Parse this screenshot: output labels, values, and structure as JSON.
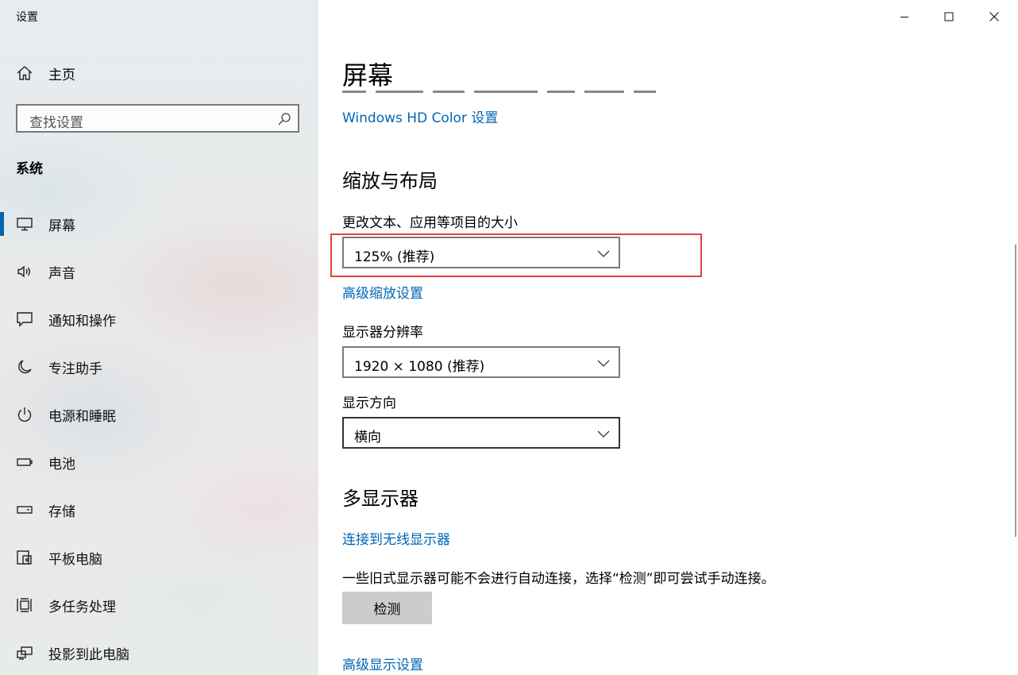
{
  "window": {
    "title": "设置",
    "controls": {
      "minimize": "minimize-icon",
      "maximize": "maximize-icon",
      "close": "close-icon"
    }
  },
  "sidebar": {
    "home_label": "主页",
    "search_placeholder": "查找设置",
    "section_label": "系统",
    "items": [
      {
        "label": "屏幕",
        "icon": "monitor-icon",
        "active": true
      },
      {
        "label": "声音",
        "icon": "speaker-icon"
      },
      {
        "label": "通知和操作",
        "icon": "notification-icon"
      },
      {
        "label": "专注助手",
        "icon": "moon-icon"
      },
      {
        "label": "电源和睡眠",
        "icon": "power-icon"
      },
      {
        "label": "电池",
        "icon": "battery-icon"
      },
      {
        "label": "存储",
        "icon": "storage-icon"
      },
      {
        "label": "平板电脑",
        "icon": "tablet-icon"
      },
      {
        "label": "多任务处理",
        "icon": "multitask-icon"
      },
      {
        "label": "投影到此电脑",
        "icon": "project-icon"
      }
    ]
  },
  "main": {
    "title": "屏幕",
    "hd_color_link": "Windows HD Color 设置",
    "scale_section": {
      "heading": "缩放与布局",
      "size_label": "更改文本、应用等项目的大小",
      "size_value": "125% (推荐)",
      "advanced_scaling_link": "高级缩放设置",
      "resolution_label": "显示器分辨率",
      "resolution_value": "1920 × 1080 (推荐)",
      "orientation_label": "显示方向",
      "orientation_value": "横向"
    },
    "multi_display": {
      "heading": "多显示器",
      "wireless_link": "连接到无线显示器",
      "description": "一些旧式显示器可能不会进行自动连接，选择“检测”即可尝试手动连接。",
      "detect_button": "检测",
      "advanced_display_link": "高级显示设置"
    }
  },
  "colors": {
    "accent": "#0063b1",
    "link": "#0066b4",
    "highlight_box": "#e0413f"
  }
}
